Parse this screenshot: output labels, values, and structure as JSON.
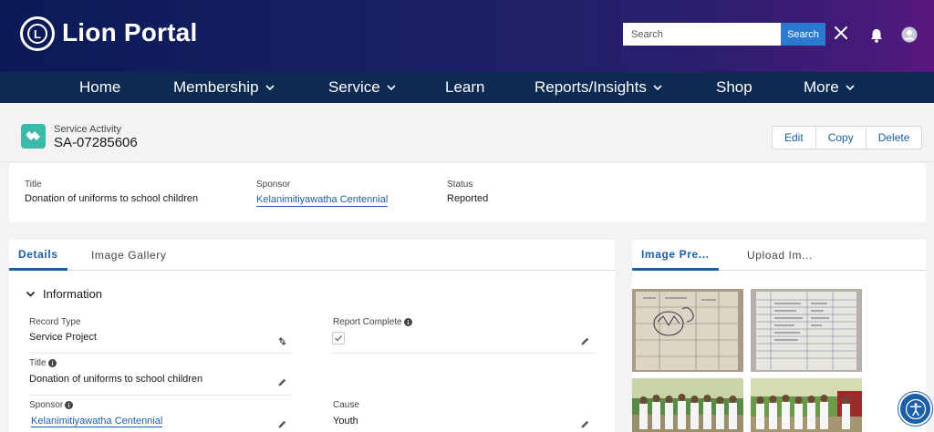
{
  "header": {
    "brand": "Lion Portal",
    "logo_text": "L",
    "search": {
      "placeholder": "Search",
      "button_label": "Search"
    }
  },
  "nav": {
    "items": [
      {
        "label": "Home",
        "dropdown": false
      },
      {
        "label": "Membership",
        "dropdown": true
      },
      {
        "label": "Service",
        "dropdown": true
      },
      {
        "label": "Learn",
        "dropdown": false
      },
      {
        "label": "Reports/Insights",
        "dropdown": true
      },
      {
        "label": "Shop",
        "dropdown": false
      },
      {
        "label": "More",
        "dropdown": true
      }
    ]
  },
  "record": {
    "type": "Service Activity",
    "name": "SA-07285606",
    "actions": [
      "Edit",
      "Copy",
      "Delete"
    ]
  },
  "highlights": {
    "title_label": "Title",
    "title_value": "Donation of uniforms to school children",
    "sponsor_label": "Sponsor",
    "sponsor_value": "Kelanimitiyawatha Centennial",
    "status_label": "Status",
    "status_value": "Reported"
  },
  "details": {
    "tabs": [
      "Details",
      "Image Gallery"
    ],
    "section_title": "Information",
    "fields": {
      "record_type_label": "Record Type",
      "record_type_value": "Service Project",
      "report_complete_label": "Report Complete",
      "report_complete_checked": true,
      "title_label": "Title",
      "title_value": "Donation of uniforms to school children",
      "sponsor_label": "Sponsor",
      "sponsor_value": "Kelanimitiyawatha Centennial",
      "cause_label": "Cause",
      "cause_value": "Youth"
    }
  },
  "gallery": {
    "tabs": [
      "Image Pre...",
      "Upload Im..."
    ]
  },
  "colors": {
    "header_start": "#0b1a57",
    "header_end": "#5a1880",
    "nav_bg": "#0d2a52",
    "accent": "#1b5fa8",
    "record_icon": "#3bb9a9"
  }
}
